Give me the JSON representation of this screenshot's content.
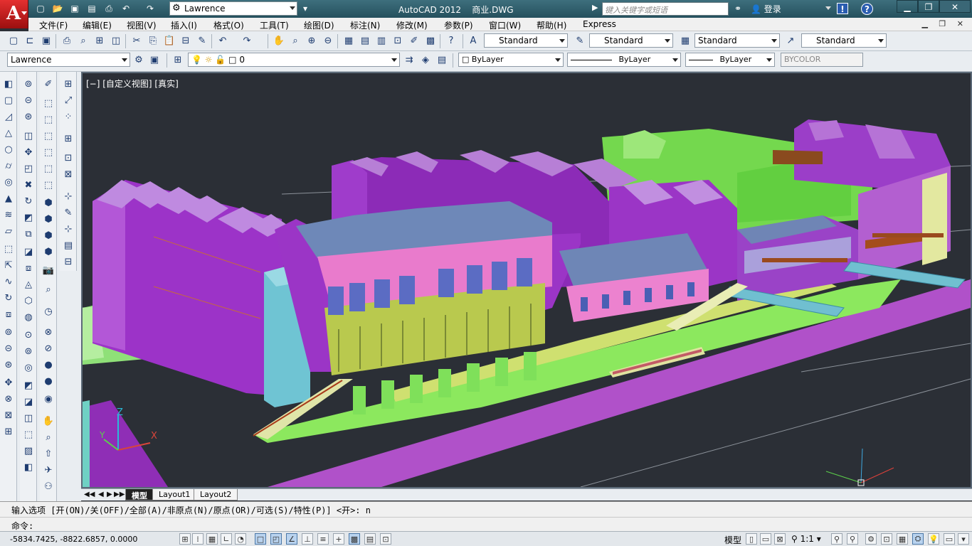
{
  "app": {
    "logo_letter": "A",
    "title": "AutoCAD 2012    商业.DWG",
    "workspace": "Lawrence",
    "search_placeholder": "键入关键字或短语",
    "login": "登录",
    "help_x": "!",
    "help_q": "?",
    "window_buttons": [
      "▁",
      "❐",
      "✕"
    ]
  },
  "quick_access_icons": [
    "new-icon",
    "open-icon",
    "save-icon",
    "save-as-icon",
    "print-icon",
    "undo-icon",
    "redo-icon"
  ],
  "menu": [
    "文件(F)",
    "编辑(E)",
    "视图(V)",
    "插入(I)",
    "格式(O)",
    "工具(T)",
    "绘图(D)",
    "标注(N)",
    "修改(M)",
    "参数(P)",
    "窗口(W)",
    "帮助(H)",
    "Express"
  ],
  "mdi_controls": "▁ ❐ ✕",
  "styles_toolbar": {
    "text_style": "Standard",
    "dim_style": "Standard",
    "table_style": "Standard",
    "mleader_style": "Standard"
  },
  "layers_toolbar": {
    "workspace": "Lawrence",
    "layer": "0",
    "color": "ByLayer",
    "linetype": "ByLayer",
    "lineweight": "ByLayer",
    "plotstyle": "BYCOLOR"
  },
  "viewport": {
    "label": "[−] [自定义视图] [真实]",
    "ucs": {
      "z": "Z",
      "x": "X",
      "y": "Y"
    }
  },
  "tabs": [
    "模型",
    "Layout1",
    "Layout2"
  ],
  "command": {
    "history": "输入选项 [开(ON)/关(OFF)/全部(A)/非原点(N)/原点(OR)/可选(S)/特性(P)] <开>: n",
    "prompt": "命令:"
  },
  "status": {
    "coords": "-5834.7425, -8822.6857, 0.0000",
    "model": "模型",
    "scale": "1:1"
  },
  "colors": {
    "purple": "#9b2fc4",
    "green": "#7ee05a",
    "pink": "#e877c7",
    "blue_roof": "#6d86b8",
    "cyan": "#6fc7d6",
    "yellow_green": "#bfcf55"
  }
}
